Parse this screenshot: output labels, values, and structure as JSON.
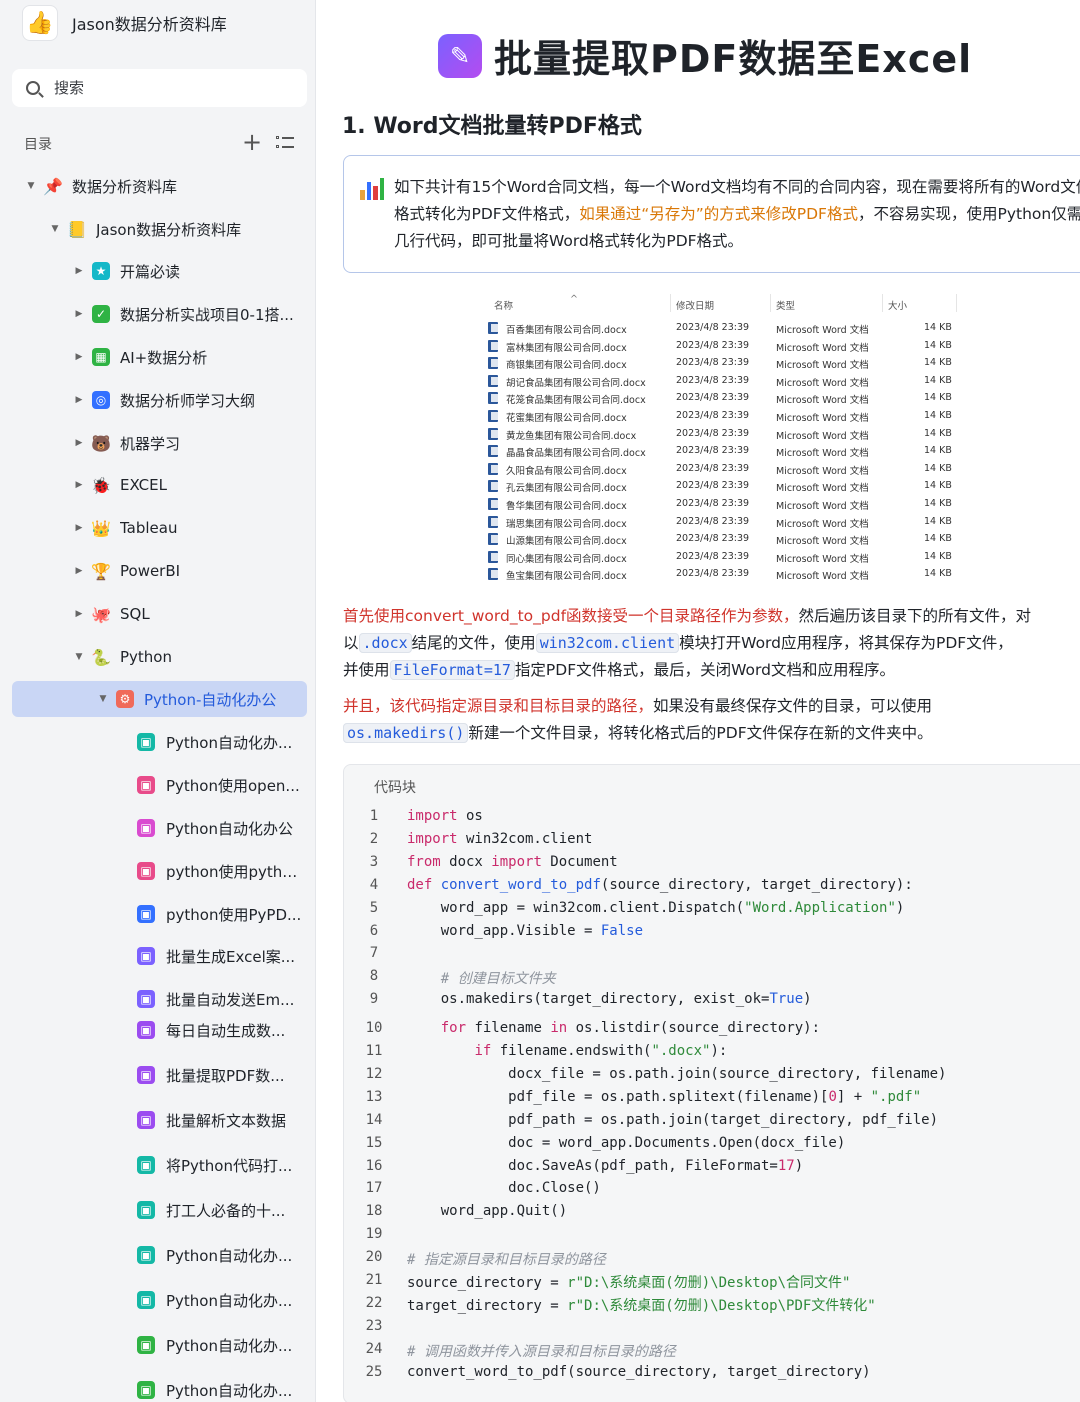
{
  "workspace": {
    "title": "Jason数据分析资料库"
  },
  "search": {
    "placeholder": "搜索"
  },
  "toc": {
    "label": "目录"
  },
  "nav": [
    {
      "label": "数据分析资料库",
      "icon": "pin-icon",
      "color": "#e03e3e"
    },
    {
      "label": "Jason数据分析资料库",
      "icon": "folder-icon",
      "color": "#4b8a2a"
    },
    {
      "label": "开篇必读",
      "icon": "star-icon",
      "color": "#14b8c8"
    },
    {
      "label": "数据分析实战项目0-1搭...",
      "icon": "doc-icon",
      "color": "#2fb344"
    },
    {
      "label": "AI+数据分析",
      "icon": "chart-icon",
      "color": "#2fb344"
    },
    {
      "label": "数据分析师学习大纲",
      "icon": "target-icon",
      "color": "#3370ff"
    },
    {
      "label": "机器学习",
      "icon": "robot-icon",
      "color": "#333333"
    },
    {
      "label": "EXCEL",
      "icon": "bug-icon",
      "color": "#b02a1a"
    },
    {
      "label": "Tableau",
      "icon": "crown-icon",
      "color": "#d4a017"
    },
    {
      "label": "PowerBI",
      "icon": "trophy-icon",
      "color": "#3a6b2a"
    },
    {
      "label": "SQL",
      "icon": "database-icon",
      "color": "#2b7ab8"
    },
    {
      "label": "Python",
      "icon": "python-icon",
      "color": "#3a6b2a"
    },
    {
      "label": "Python-自动化办公",
      "icon": "gear-icon",
      "color": "#f06a5a"
    },
    {
      "label": "Python自动化办...",
      "icon": "page-icon",
      "color": "#14b8a6"
    },
    {
      "label": "Python使用open...",
      "icon": "page-icon",
      "color": "#e84b8a"
    },
    {
      "label": "Python自动化办公",
      "icon": "page-icon",
      "color": "#d94bd0"
    },
    {
      "label": "python使用pytho...",
      "icon": "page-icon",
      "color": "#e84b8a"
    },
    {
      "label": "python使用PyPD...",
      "icon": "page-icon",
      "color": "#3370ff"
    },
    {
      "label": "批量生成Excel案...",
      "icon": "page-icon",
      "color": "#7b61ff"
    },
    {
      "label": "批量自动发送Em...",
      "icon": "page-icon",
      "color": "#7b61ff"
    },
    {
      "label": "每日自动生成数...",
      "icon": "page-icon",
      "color": "#9b4cf0"
    },
    {
      "label": "批量提取PDF数...",
      "icon": "page-icon",
      "color": "#9b4cf0"
    },
    {
      "label": "批量解析文本数据",
      "icon": "page-icon",
      "color": "#9b4cf0"
    },
    {
      "label": "将Python代码打...",
      "icon": "page-icon",
      "color": "#14b8a6"
    },
    {
      "label": "打工人必备的十...",
      "icon": "page-icon",
      "color": "#14b8a6"
    },
    {
      "label": "Python自动化办...",
      "icon": "page-icon",
      "color": "#14b8a6"
    },
    {
      "label": "Python自动化办...",
      "icon": "page-icon",
      "color": "#14b8a6"
    },
    {
      "label": "Python自动化办...",
      "icon": "page-icon",
      "color": "#2fb344"
    },
    {
      "label": "Python自动化办...",
      "icon": "page-icon",
      "color": "#2fb344"
    }
  ],
  "doc": {
    "title": "批量提取PDF数据至Excel",
    "h2": "1. Word文档批量转PDF格式",
    "callout": {
      "part1": "如下共计有15个Word合同文档，每一个Word文档均有不同的合同内容，现在需要将所有的Word文件格式转化为PDF文件格式，",
      "highlight": "如果通过“另存为”的方式来修改PDF格式",
      "part2": "，不容易实现，使用Python仅需几行代码，即可批量将Word格式转化为PDF格式。"
    },
    "p1": {
      "red": "首先使用convert_word_to_pdf函数接受一个目录路径作为参数，",
      "t1": "然后遍历该目录下的所有文件，对",
      "t2": "以",
      "c1": ".docx",
      "t3": "结尾的文件，使用",
      "c2": "win32com.client",
      "t4": "模块打开Word应用程序，将其保存为PDF文件，",
      "t5": "并使用",
      "c3": "FileFormat=17",
      "t6": "指定PDF文件格式，最后，关闭Word文档和应用程序。"
    },
    "p2": {
      "red": "并且，该代码指定源目录和目标目录的路径，",
      "t1": "如果没有最终保存文件的目录，可以使用",
      "c1": "os.makedirs()",
      "t2": "新建一个文件目录，将转化格式后的PDF文件保存在新的文件夹中。"
    }
  },
  "filelist": {
    "headers": [
      "名称",
      "修改日期",
      "类型",
      "大小"
    ],
    "rows": [
      {
        "name": "百香集团有限公司合同.docx",
        "date": "2023/4/8 23:39",
        "type": "Microsoft Word 文档",
        "size": "14 KB"
      },
      {
        "name": "富林集团有限公司合同.docx",
        "date": "2023/4/8 23:39",
        "type": "Microsoft Word 文档",
        "size": "14 KB"
      },
      {
        "name": "商银集团有限公司合同.docx",
        "date": "2023/4/8 23:39",
        "type": "Microsoft Word 文档",
        "size": "14 KB"
      },
      {
        "name": "胡记食品集团有限公司合同.docx",
        "date": "2023/4/8 23:39",
        "type": "Microsoft Word 文档",
        "size": "14 KB"
      },
      {
        "name": "花笼食品集团有限公司合同.docx",
        "date": "2023/4/8 23:39",
        "type": "Microsoft Word 文档",
        "size": "14 KB"
      },
      {
        "name": "花蜜集团有限公司合同.docx",
        "date": "2023/4/8 23:39",
        "type": "Microsoft Word 文档",
        "size": "14 KB"
      },
      {
        "name": "黄龙鱼集团有限公司合同.docx",
        "date": "2023/4/8 23:39",
        "type": "Microsoft Word 文档",
        "size": "14 KB"
      },
      {
        "name": "晶晶食品集团有限公司合同.docx",
        "date": "2023/4/8 23:39",
        "type": "Microsoft Word 文档",
        "size": "14 KB"
      },
      {
        "name": "久阳食品有限公司合同.docx",
        "date": "2023/4/8 23:39",
        "type": "Microsoft Word 文档",
        "size": "14 KB"
      },
      {
        "name": "孔云集团有限公司合同.docx",
        "date": "2023/4/8 23:39",
        "type": "Microsoft Word 文档",
        "size": "14 KB"
      },
      {
        "name": "鲁华集团有限公司合同.docx",
        "date": "2023/4/8 23:39",
        "type": "Microsoft Word 文档",
        "size": "14 KB"
      },
      {
        "name": "瑞思集团有限公司合同.docx",
        "date": "2023/4/8 23:39",
        "type": "Microsoft Word 文档",
        "size": "14 KB"
      },
      {
        "name": "山源集团有限公司合同.docx",
        "date": "2023/4/8 23:39",
        "type": "Microsoft Word 文档",
        "size": "14 KB"
      },
      {
        "name": "同心集团有限公司合同.docx",
        "date": "2023/4/8 23:39",
        "type": "Microsoft Word 文档",
        "size": "14 KB"
      },
      {
        "name": "鱼宝集团有限公司合同.docx",
        "date": "2023/4/8 23:39",
        "type": "Microsoft Word 文档",
        "size": "14 KB"
      }
    ]
  },
  "codeblock": {
    "label": "代码块",
    "lines": [
      [
        [
          "kw",
          "import"
        ],
        [
          "t",
          " os"
        ]
      ],
      [
        [
          "kw",
          "import"
        ],
        [
          "t",
          " win32com.client"
        ]
      ],
      [
        [
          "kw",
          "from"
        ],
        [
          "t",
          " docx "
        ],
        [
          "kw",
          "import"
        ],
        [
          "t",
          " Document"
        ]
      ],
      [
        [
          "kw",
          "def"
        ],
        [
          "t",
          " "
        ],
        [
          "fn",
          "convert_word_to_pdf"
        ],
        [
          "t",
          "(source_directory, target_directory):"
        ]
      ],
      [
        [
          "t",
          "    word_app = win32com.client.Dispatch("
        ],
        [
          "str",
          "\"Word.Application\""
        ],
        [
          "t",
          ")"
        ]
      ],
      [
        [
          "t",
          "    word_app.Visible = "
        ],
        [
          "bo",
          "False"
        ]
      ],
      [
        [
          "t",
          ""
        ]
      ],
      [
        [
          "t",
          "    "
        ],
        [
          "cm",
          "# 创建目标文件夹"
        ]
      ],
      [
        [
          "t",
          "    os.makedirs(target_directory, exist_ok="
        ],
        [
          "bo",
          "True"
        ],
        [
          "t",
          ")"
        ]
      ],
      [
        [
          "t",
          "    "
        ],
        [
          "kw",
          "for"
        ],
        [
          "t",
          " filename "
        ],
        [
          "kw",
          "in"
        ],
        [
          "t",
          " os.listdir(source_directory):"
        ]
      ],
      [
        [
          "t",
          "        "
        ],
        [
          "kw",
          "if"
        ],
        [
          "t",
          " filename.endswith("
        ],
        [
          "str",
          "\".docx\""
        ],
        [
          "t",
          "):"
        ]
      ],
      [
        [
          "t",
          "            docx_file = os.path.join(source_directory, filename)"
        ]
      ],
      [
        [
          "t",
          "            pdf_file = os.path.splitext(filename)["
        ],
        [
          "num",
          "0"
        ],
        [
          "t",
          "] + "
        ],
        [
          "str",
          "\".pdf\""
        ]
      ],
      [
        [
          "t",
          "            pdf_path = os.path.join(target_directory, pdf_file)"
        ]
      ],
      [
        [
          "t",
          "            doc = word_app.Documents.Open(docx_file)"
        ]
      ],
      [
        [
          "t",
          "            doc.SaveAs(pdf_path, FileFormat="
        ],
        [
          "num",
          "17"
        ],
        [
          "t",
          ")"
        ]
      ],
      [
        [
          "t",
          "            doc.Close()"
        ]
      ],
      [
        [
          "t",
          "    word_app.Quit()"
        ]
      ],
      [
        [
          "t",
          ""
        ]
      ],
      [
        [
          "cm",
          "# 指定源目录和目标目录的路径"
        ]
      ],
      [
        [
          "t",
          "source_directory = "
        ],
        [
          "str",
          "r\"D:\\系统桌面(勿删)\\Desktop\\合同文件\""
        ]
      ],
      [
        [
          "t",
          "target_directory = "
        ],
        [
          "str",
          "r\"D:\\系统桌面(勿删)\\Desktop\\PDF文件转化\""
        ]
      ],
      [
        [
          "t",
          ""
        ]
      ],
      [
        [
          "cm",
          "# 调用函数并传入源目录和目标目录的路径"
        ]
      ],
      [
        [
          "t",
          "convert_word_to_pdf(source_directory, target_directory)"
        ]
      ]
    ]
  }
}
